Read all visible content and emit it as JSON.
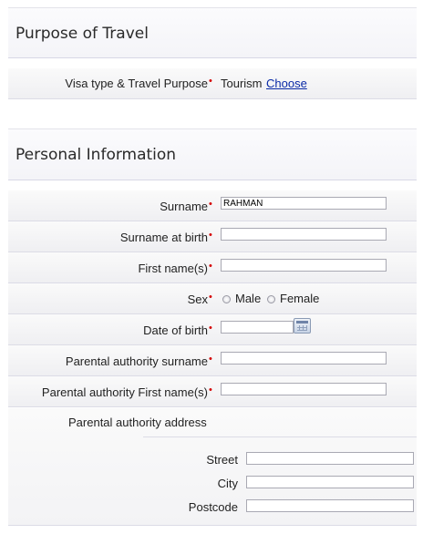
{
  "purpose": {
    "title": "Purpose of Travel",
    "visa_label": "Visa type & Travel Purpose",
    "visa_value": "Tourism",
    "choose_link": "Choose"
  },
  "personal": {
    "title": "Personal Information",
    "required_mark": "•",
    "surname_label": "Surname",
    "surname_value": "RAHMAN",
    "surname_birth_label": "Surname at birth",
    "first_name_label": "First name(s)",
    "sex_label": "Sex",
    "sex_options": [
      "Male",
      "Female"
    ],
    "dob_label": "Date of birth",
    "parent_surname_label": "Parental authority surname",
    "parent_first_label": "Parental authority First name(s)",
    "address": {
      "title": "Parental authority address",
      "street_label": "Street",
      "city_label": "City",
      "postcode_label": "Postcode"
    }
  },
  "icons": {
    "calendar": "calendar-icon"
  }
}
